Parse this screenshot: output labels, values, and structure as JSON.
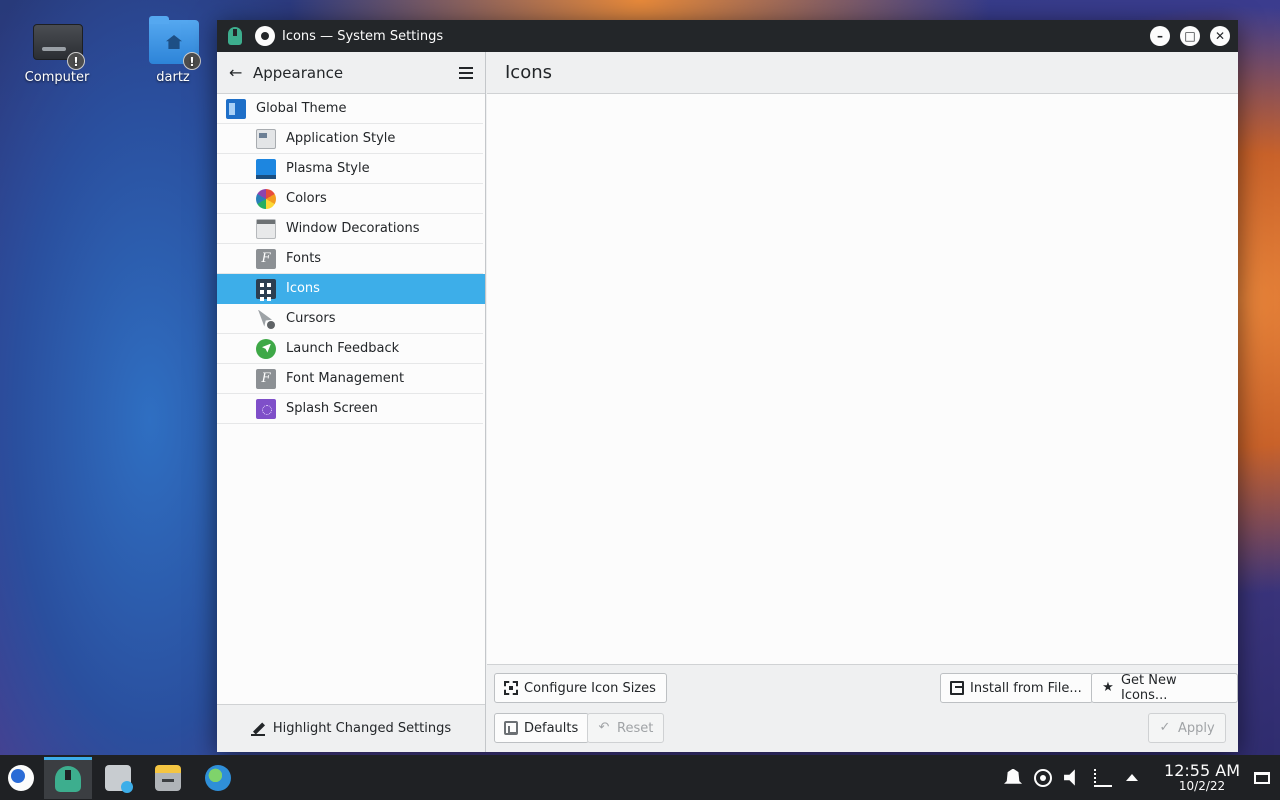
{
  "desktop": {
    "icons": [
      {
        "label": "Computer",
        "icon": "drive-icon"
      },
      {
        "label": "dartz",
        "icon": "home-folder-icon"
      }
    ]
  },
  "window": {
    "title": "Icons — System Settings",
    "controls": {
      "minimize": "–",
      "maximize": "□",
      "close": "✕"
    }
  },
  "sidebar": {
    "header_title": "Appearance",
    "items": [
      {
        "label": "Global Theme",
        "level": "top",
        "icon": "global-theme-icon"
      },
      {
        "label": "Application Style",
        "level": "sub",
        "icon": "application-style-icon"
      },
      {
        "label": "Plasma Style",
        "level": "sub",
        "icon": "plasma-style-icon"
      },
      {
        "label": "Colors",
        "level": "sub",
        "icon": "colors-icon"
      },
      {
        "label": "Window Decorations",
        "level": "sub",
        "icon": "window-decorations-icon"
      },
      {
        "label": "Fonts",
        "level": "sub",
        "icon": "fonts-icon"
      },
      {
        "label": "Icons",
        "level": "sub",
        "icon": "icons-icon",
        "selected": true
      },
      {
        "label": "Cursors",
        "level": "sub",
        "icon": "cursors-icon"
      },
      {
        "label": "Launch Feedback",
        "level": "sub",
        "icon": "launch-feedback-icon"
      },
      {
        "label": "Font Management",
        "level": "sub",
        "icon": "font-management-icon"
      },
      {
        "label": "Splash Screen",
        "level": "sub",
        "icon": "splash-screen-icon"
      }
    ],
    "footer_label": "Highlight Changed Settings"
  },
  "content": {
    "title": "Icons",
    "buttons": {
      "configure_sizes": "Configure Icon Sizes",
      "install_from_file": "Install from File...",
      "get_new": "Get New Icons...",
      "defaults": "Defaults",
      "reset": "Reset",
      "apply": "Apply"
    }
  },
  "taskbar": {
    "tasks": [
      "system-settings-icon",
      "discover-store-icon",
      "file-manager-icon",
      "web-browser-icon"
    ],
    "clock": {
      "time": "12:55 AM",
      "date": "10/2/22"
    }
  },
  "colors": {
    "accent": "#3daee9",
    "titlebar": "#232629",
    "window_bg": "#eff0f1",
    "view_bg": "#fcfcfc"
  }
}
